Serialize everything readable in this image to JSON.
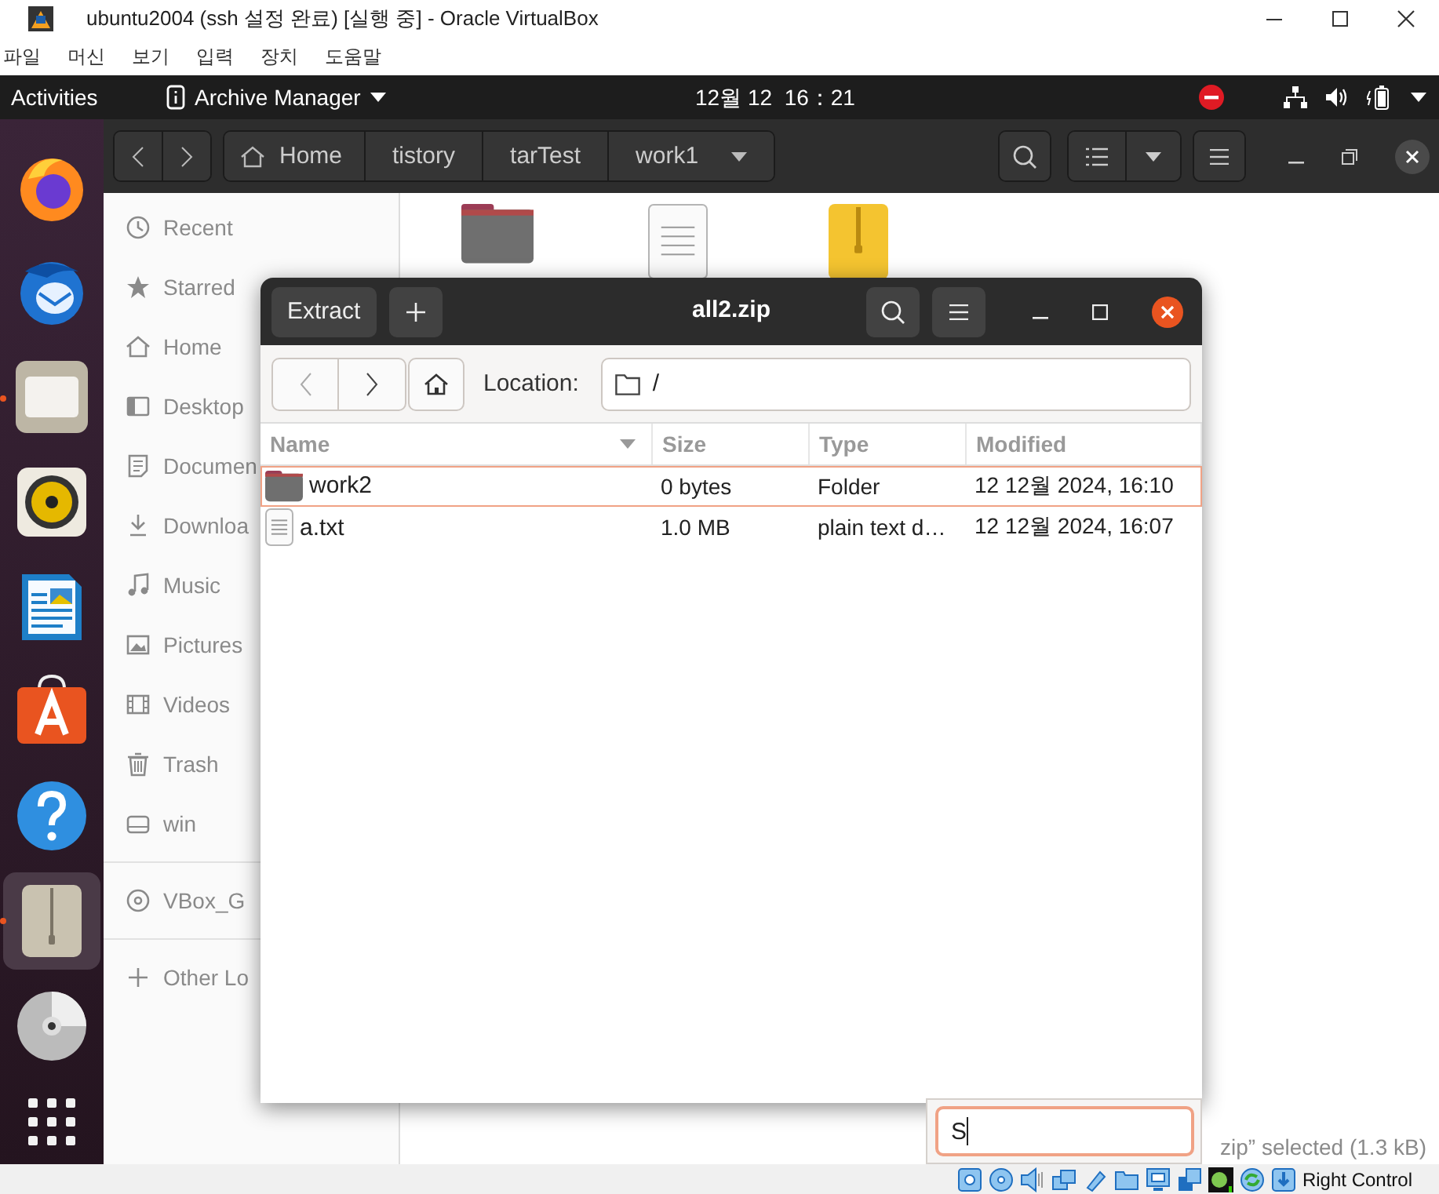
{
  "vbox": {
    "title": "ubuntu2004 (ssh 설정 완료) [실행 중] - Oracle VirtualBox",
    "menu": [
      "파일",
      "머신",
      "보기",
      "입력",
      "장치",
      "도움말"
    ]
  },
  "top_bar": {
    "activities": "Activities",
    "app_name": "Archive Manager",
    "clock": "12월 12  16：21"
  },
  "dock": {
    "items": [
      {
        "kind": "browser",
        "running": false,
        "selected": false
      },
      {
        "kind": "mail",
        "running": false,
        "selected": false
      },
      {
        "kind": "files",
        "running": true,
        "selected": false
      },
      {
        "kind": "music",
        "running": false,
        "selected": false
      },
      {
        "kind": "writer",
        "running": false,
        "selected": false
      },
      {
        "kind": "store",
        "running": false,
        "selected": false
      },
      {
        "kind": "help",
        "running": false,
        "selected": false
      },
      {
        "kind": "archive",
        "running": true,
        "selected": true
      },
      {
        "kind": "disc",
        "running": false,
        "selected": false
      },
      {
        "kind": "grid",
        "running": false,
        "selected": false
      }
    ]
  },
  "files": {
    "path": [
      "Home",
      "tistory",
      "tarTest",
      "work1"
    ],
    "sidebar": {
      "places": [
        {
          "label": "Recent",
          "kind": "recent"
        },
        {
          "label": "Starred",
          "kind": "star"
        },
        {
          "label": "Home",
          "kind": "home"
        },
        {
          "label": "Desktop",
          "kind": "desktop"
        },
        {
          "label": "Documen",
          "kind": "document"
        },
        {
          "label": "Downloa",
          "kind": "download"
        },
        {
          "label": "Music",
          "kind": "music"
        },
        {
          "label": "Pictures",
          "kind": "picture"
        },
        {
          "label": "Videos",
          "kind": "video"
        },
        {
          "label": "Trash",
          "kind": "trash"
        },
        {
          "label": "win",
          "kind": "drive"
        }
      ],
      "devices": [
        {
          "label": "VBox_G",
          "kind": "disc"
        }
      ],
      "other": [
        {
          "label": "Other Lo",
          "kind": "plus"
        }
      ]
    },
    "items": [
      {
        "kind": "folder"
      },
      {
        "kind": "text"
      },
      {
        "kind": "zip"
      }
    ],
    "status": "zip” selected (1.3 kB)"
  },
  "archive": {
    "title": "all2.zip",
    "extract": "Extract",
    "location_label": "Location:",
    "location": "/",
    "columns": [
      "Name",
      "Size",
      "Type",
      "Modified"
    ],
    "rows": [
      {
        "kind": "folder",
        "name": "work2",
        "size": "0 bytes",
        "type": "Folder",
        "modified": "12 12월 2024, 16:10",
        "selected": true
      },
      {
        "kind": "text",
        "name": "a.txt",
        "size": "1.0 MB",
        "type": "plain text d…",
        "modified": "12 12월 2024, 16:07",
        "selected": false
      }
    ]
  },
  "search_popup": {
    "value": "S"
  },
  "vbox_status": {
    "host_key": "Right Control"
  }
}
